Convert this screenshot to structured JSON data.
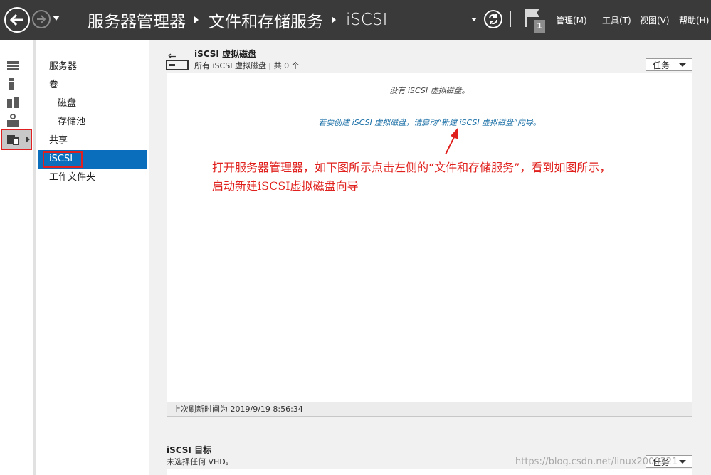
{
  "header": {
    "breadcrumb": [
      "服务器管理器",
      "文件和存储服务",
      "iSCSI"
    ],
    "menus": [
      "管理(M)",
      "工具(T)",
      "视图(V)",
      "帮助(H)"
    ],
    "notification_count": "1"
  },
  "nav": {
    "items": [
      "服务器",
      "卷",
      "磁盘",
      "存储池",
      "共享",
      "iSCSI",
      "工作文件夹"
    ],
    "selected": "iSCSI"
  },
  "section1": {
    "title": "iSCSI 虚拟磁盘",
    "subtitle": "所有 iSCSI 虚拟磁盘 | 共 0 个",
    "tasks_label": "任务",
    "empty_message": "没有 iSCSI 虚拟磁盘。",
    "create_link": "若要创建 iSCSI 虚拟磁盘，请启动“新建 iSCSI 虚拟磁盘”向导。",
    "last_refresh": "上次刷新时间为 2019/9/19 8:56:34"
  },
  "annotation": {
    "line1": "打开服务器管理器，如下图所示点击左侧的“文件和存储服务”，看到如图所示，",
    "line2": "启动新建iSCSI虚拟磁盘向导",
    "color": "#e0201c"
  },
  "section2": {
    "title": "iSCSI 目标",
    "subtitle": "未选择任何 VHD。",
    "tasks_label": "任务"
  },
  "watermark": "https://blog.csdn.net/linux2000321",
  "colors": {
    "header_bg": "#3a3a3a",
    "selection": "#0a6ebd",
    "link": "#1a6fa6"
  }
}
